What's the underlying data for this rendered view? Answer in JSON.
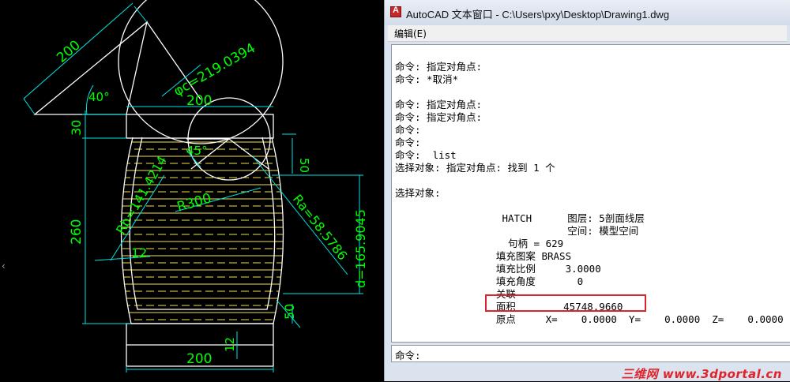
{
  "cad": {
    "dims": {
      "slant_200": "200",
      "angle_40": "40°",
      "dia_c": "φc=219.0394",
      "top_200": "200",
      "left_30": "30",
      "angle_45": "45°",
      "right_50": "50",
      "r300": "R300",
      "rb": "Rb=141.4214",
      "ra": "Ra=58.5786",
      "d": "d=165.9045",
      "left_260": "260",
      "small_12": "12",
      "br_50": "50",
      "bottom_12": "12",
      "bottom_200": "200"
    },
    "colors": {
      "geometry": "#ffffff",
      "dimension": "#00e4e4",
      "dim_text": "#00ff00",
      "hatch": "#f2e04a"
    },
    "scroll_glyph": "‹"
  },
  "window": {
    "title": "AutoCAD 文本窗口 - C:\\Users\\pxy\\Desktop\\Drawing1.dwg",
    "menu": {
      "edit": "编辑(E)"
    },
    "lines": [
      {
        "t": "命令: 指定对角点:"
      },
      {
        "t": "命令: *取消*"
      },
      {
        "t": ""
      },
      {
        "t": "命令: 指定对角点:"
      },
      {
        "t": "命令: 指定对角点:"
      },
      {
        "t": "命令:"
      },
      {
        "t": "命令:"
      },
      {
        "t": "命令:  list"
      },
      {
        "t": "选择对象: 指定对角点: 找到 1 个"
      },
      {
        "t": ""
      },
      {
        "t": "选择对象:"
      },
      {
        "t": ""
      },
      {
        "t": "                  HATCH      图层: 5剖面线层"
      },
      {
        "t": "                             空间: 模型空间"
      },
      {
        "t": "                   句柄 = 629"
      },
      {
        "t": "                 填充图案 BRASS"
      },
      {
        "t": "                 填充比例     3.0000"
      },
      {
        "t": "                 填充角度       0"
      },
      {
        "t": "                 关联"
      },
      {
        "t": "                 面积        45748.9660"
      },
      {
        "t": "                 原点     X=    0.0000  Y=    0.0000  Z=    0.0000"
      }
    ],
    "highlight_color": "#d9262c",
    "cmd_prompt": "命令:",
    "watermark": "三维网 www.3dportal.cn"
  }
}
